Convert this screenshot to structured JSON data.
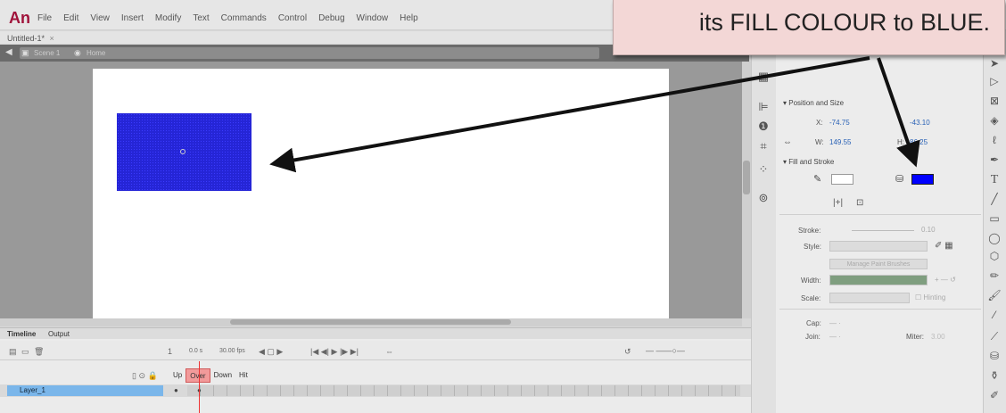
{
  "app": {
    "logo": "An"
  },
  "menu": [
    "File",
    "Edit",
    "View",
    "Insert",
    "Modify",
    "Text",
    "Commands",
    "Control",
    "Debug",
    "Window",
    "Help"
  ],
  "document": {
    "tab_label": "Untitled-1*",
    "tab_close": "×"
  },
  "breadcrumb": {
    "scene": "Scene 1",
    "symbol": "Home"
  },
  "callout": {
    "text": "its FILL COLOUR to BLUE."
  },
  "timeline": {
    "tabs": [
      "Timeline",
      "Output"
    ],
    "time": "0.0 s",
    "fps": "30.00 fps",
    "frame_labels": [
      "Up",
      "Over",
      "Down",
      "Hit"
    ],
    "layer_name": "Layer_1",
    "active_frame": "Over"
  },
  "properties": {
    "position_size_header": "Position and Size",
    "x_label": "X:",
    "x_value": "-74.75",
    "y_value": "-43.10",
    "w_label": "W:",
    "w_value": "149.55",
    "h_label": "H:",
    "h_value": "86.25",
    "fill_stroke_header": "Fill and Stroke",
    "fill_color": "#0000ff",
    "stroke_label": "Stroke:",
    "stroke_value": "0.10",
    "style_label": "Style:",
    "manage_brushes": "Manage Paint Brushes",
    "width_label": "Width:",
    "scale_label": "Scale:",
    "hinting_label": "Hinting",
    "cap_label": "Cap:",
    "join_label": "Join:",
    "miter_label": "Miter:",
    "miter_value": "3.00"
  },
  "shape": {
    "fill": "#2525d6"
  }
}
